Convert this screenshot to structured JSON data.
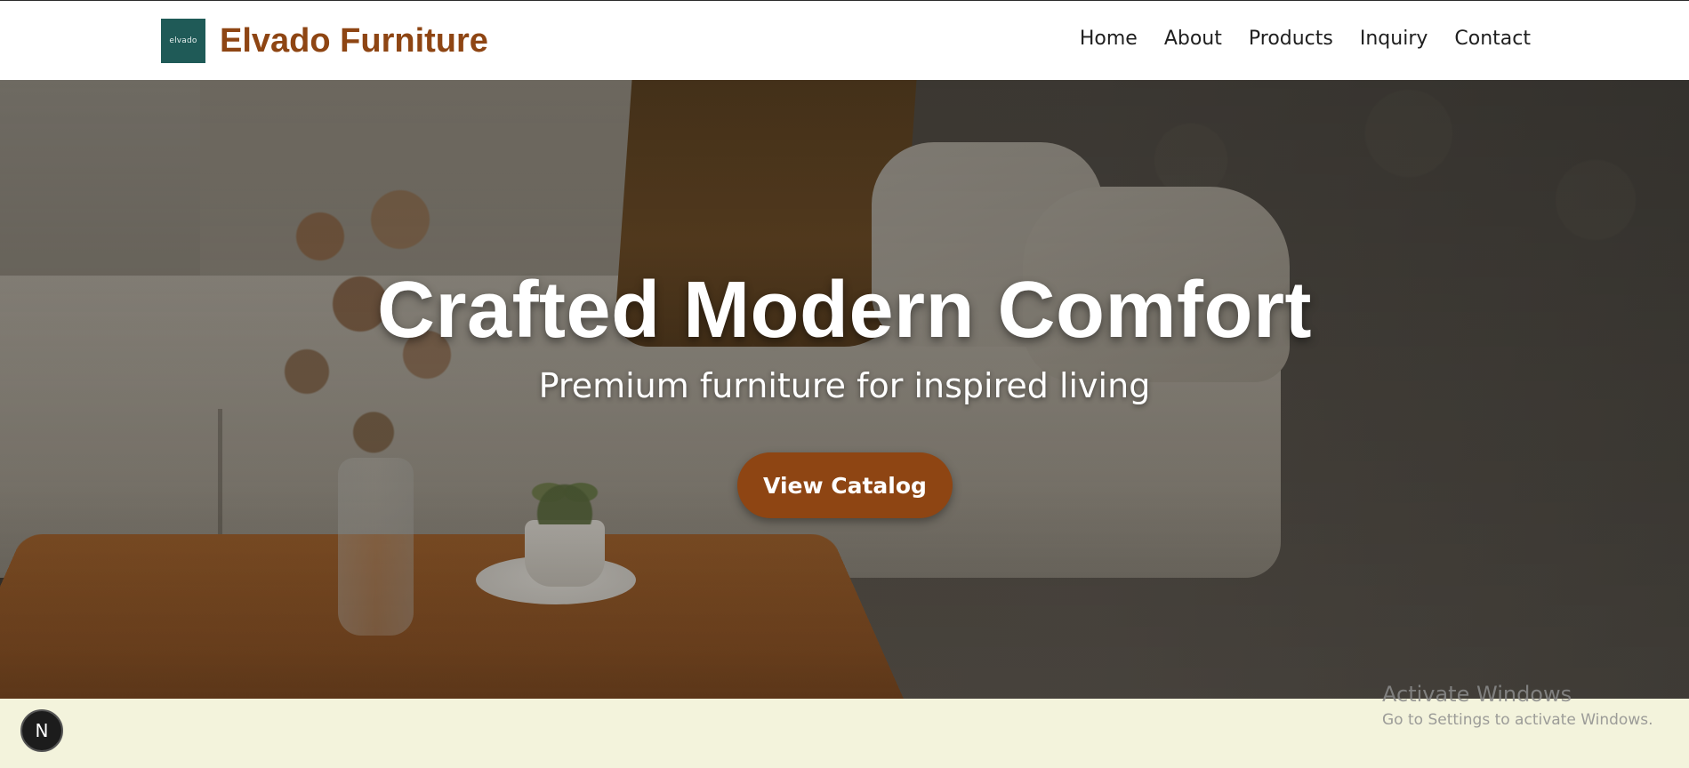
{
  "header": {
    "logo_text": "elvado",
    "brand_name": "Elvado Furniture",
    "nav": [
      "Home",
      "About",
      "Products",
      "Inquiry",
      "Contact"
    ]
  },
  "hero": {
    "title": "Crafted Modern Comfort",
    "subtitle": "Premium furniture for inspired living",
    "cta_label": "View Catalog"
  },
  "dev_badge": {
    "label": "N"
  },
  "windows_watermark": {
    "title": "Activate Windows",
    "subtitle": "Go to Settings to activate Windows."
  },
  "colors": {
    "brand": "#8e4513",
    "logo_bg": "#1f5a57",
    "band_bg": "#f3f3dc"
  }
}
